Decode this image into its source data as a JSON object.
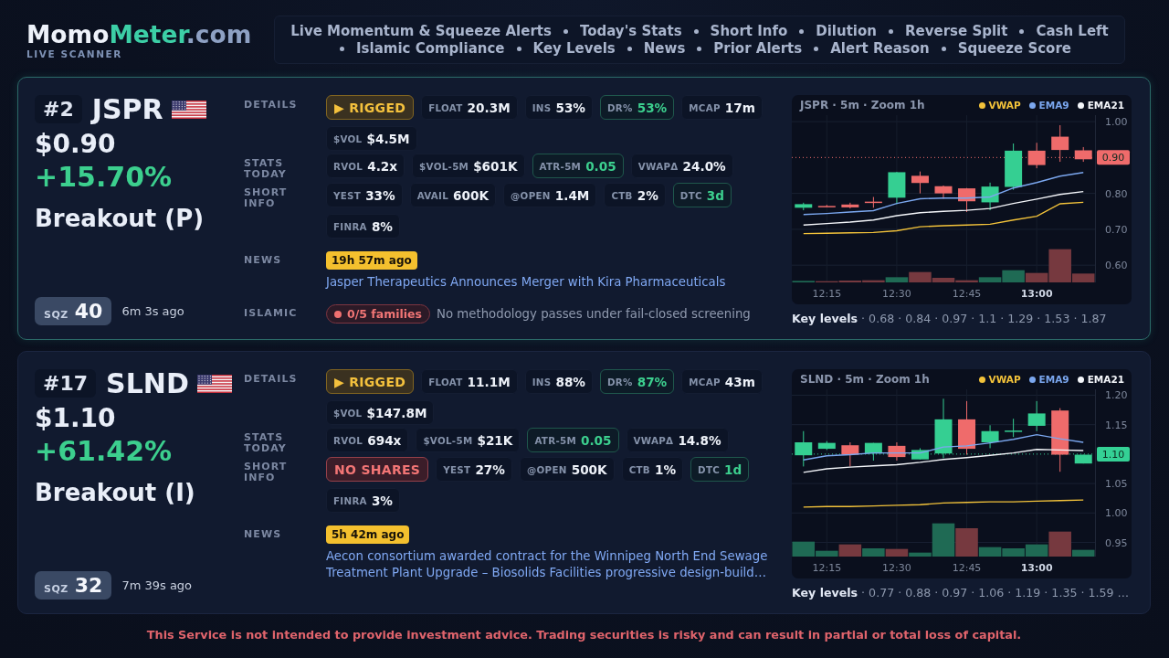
{
  "header": {
    "logo": [
      "Momo",
      "Meter",
      ".com"
    ],
    "tagline": "LIVE SCANNER",
    "nav": [
      "Live Momentum & Squeeze Alerts",
      "Today's Stats",
      "Short Info",
      "Dilution",
      "Reverse Split",
      "Cash Left",
      "Islamic Compliance",
      "Key Levels",
      "News",
      "Prior Alerts",
      "Alert Reason",
      "Squeeze Score"
    ]
  },
  "cards": [
    {
      "selected": true,
      "rank": "#2",
      "ticker": "JSPR",
      "price": "$0.90",
      "change": "+15.70%",
      "positive": true,
      "setup": "Breakout (P)",
      "sqz": {
        "label": "SQZ",
        "value": "40"
      },
      "age": "6m 3s ago",
      "sections": [
        {
          "label": "DETAILS",
          "chips": [
            {
              "kind": "warning",
              "text": "▶ RIGGED"
            },
            {
              "kind": "stat",
              "label": "FLOAT",
              "value": "20.3M",
              "positive": false
            },
            {
              "kind": "stat",
              "label": "INS",
              "value": "53%",
              "positive": false
            },
            {
              "kind": "stat",
              "label": "DR%",
              "value": "53%",
              "positive": true
            },
            {
              "kind": "stat",
              "label": "MCAP",
              "value": "17m",
              "positive": false
            },
            {
              "kind": "stat",
              "label": "$VOL",
              "value": "$4.5M",
              "positive": false
            }
          ]
        },
        {
          "label": "STATS TODAY",
          "chips": [
            {
              "kind": "stat",
              "label": "RVOL",
              "value": "4.2x",
              "positive": false
            },
            {
              "kind": "stat",
              "label": "$VOL-5M",
              "value": "$601K",
              "positive": false
            },
            {
              "kind": "stat",
              "label": "ATR-5M",
              "value": "0.05",
              "positive": true
            },
            {
              "kind": "stat",
              "label": "VWAPΔ",
              "value": "24.0%",
              "positive": false
            }
          ]
        },
        {
          "label": "SHORT INFO",
          "chips": [
            {
              "kind": "stat",
              "label": "YEST",
              "value": "33%",
              "positive": false
            },
            {
              "kind": "stat",
              "label": "AVAIL",
              "value": "600K",
              "positive": false
            },
            {
              "kind": "stat",
              "label": "@OPEN",
              "value": "1.4M",
              "positive": false
            },
            {
              "kind": "stat",
              "label": "CTB",
              "value": "2%",
              "positive": false
            },
            {
              "kind": "stat",
              "label": "DTC",
              "value": "3d",
              "positive": true
            },
            {
              "kind": "stat",
              "label": "FINRA",
              "value": "8%",
              "positive": false
            }
          ]
        }
      ],
      "news": {
        "label": "NEWS",
        "age": "19h 57m ago",
        "headline": "Jasper Therapeutics Announces Merger with Kira Pharmaceuticals"
      },
      "islamic": {
        "label": "ISLAMIC",
        "passed": false,
        "badge": "0/5 families",
        "note": "No methodology passes under fail-closed screening"
      },
      "chart": {
        "chart_data": {
          "type": "line",
          "title": "JSPR · 5m · Zoom 1h",
          "categories": [
            null,
            "12:15",
            null,
            null,
            "12:30",
            null,
            null,
            "12:45",
            null,
            null,
            "13:00",
            null,
            null
          ],
          "series": [
            {
              "name": "VWAP",
              "color": "#f2c23a",
              "values": [
                0.688,
                0.689,
                0.69,
                0.691,
                0.696,
                0.707,
                0.71,
                0.712,
                0.714,
                0.726,
                0.736,
                0.771,
                0.775
              ]
            },
            {
              "name": "EMA9",
              "color": "#7ba7ef",
              "values": [
                0.741,
                0.744,
                0.748,
                0.752,
                0.772,
                0.785,
                0.787,
                0.787,
                0.79,
                0.815,
                0.83,
                0.848,
                0.858
              ]
            },
            {
              "name": "EMA21",
              "color": "#f4f6fa",
              "values": [
                0.712,
                0.716,
                0.72,
                0.726,
                0.738,
                0.746,
                0.75,
                0.753,
                0.758,
                0.772,
                0.784,
                0.797,
                0.805
              ]
            }
          ],
          "ylim": [
            0.552,
            1.018
          ],
          "yticks": [
            {
              "value": 0.6,
              "label": "0.60"
            },
            {
              "value": 0.7,
              "label": "0.70"
            },
            {
              "value": 0.8,
              "label": "0.80"
            },
            {
              "value": 1.0,
              "label": "1.00"
            }
          ],
          "grid": true,
          "legend": "upper right",
          "ref_lines": [
            {
              "axis": "y",
              "value": 0.9,
              "label": "0.90",
              "color": "#ef6b6b"
            }
          ]
        },
        "key_levels": "**Key levels** · 0.68 · 0.84 · 0.97 · 1.1 · 1.29 · 1.53 · 1.87"
      }
    },
    {
      "selected": false,
      "rank": "#17",
      "ticker": "SLND",
      "price": "$1.10",
      "change": "+61.42%",
      "positive": true,
      "setup": "Breakout (I)",
      "sqz": {
        "label": "SQZ",
        "value": "32"
      },
      "age": "7m 39s ago",
      "sections": [
        {
          "label": "DETAILS",
          "chips": [
            {
              "kind": "warning",
              "text": "▶ RIGGED"
            },
            {
              "kind": "stat",
              "label": "FLOAT",
              "value": "11.1M",
              "positive": false
            },
            {
              "kind": "stat",
              "label": "INS",
              "value": "88%",
              "positive": false
            },
            {
              "kind": "stat",
              "label": "DR%",
              "value": "87%",
              "positive": true
            },
            {
              "kind": "stat",
              "label": "MCAP",
              "value": "43m",
              "positive": false
            },
            {
              "kind": "stat",
              "label": "$VOL",
              "value": "$147.8M",
              "positive": false
            }
          ]
        },
        {
          "label": "STATS TODAY",
          "chips": [
            {
              "kind": "stat",
              "label": "RVOL",
              "value": "694x",
              "positive": false
            },
            {
              "kind": "stat",
              "label": "$VOL-5M",
              "value": "$21K",
              "positive": false
            },
            {
              "kind": "stat",
              "label": "ATR-5M",
              "value": "0.05",
              "positive": true
            },
            {
              "kind": "stat",
              "label": "VWAPΔ",
              "value": "14.8%",
              "positive": false
            }
          ]
        },
        {
          "label": "SHORT INFO",
          "chips": [
            {
              "kind": "danger",
              "text": "NO SHARES"
            },
            {
              "kind": "stat",
              "label": "YEST",
              "value": "27%",
              "positive": false
            },
            {
              "kind": "stat",
              "label": "@OPEN",
              "value": "500K",
              "positive": false
            },
            {
              "kind": "stat",
              "label": "CTB",
              "value": "1%",
              "positive": false
            },
            {
              "kind": "stat",
              "label": "DTC",
              "value": "1d",
              "positive": true
            },
            {
              "kind": "stat",
              "label": "FINRA",
              "value": "3%",
              "positive": false
            }
          ]
        }
      ],
      "news": {
        "label": "NEWS",
        "age": "5h 42m ago",
        "headline": "Aecon consortium awarded contract for the Winnipeg North End Sewage Treatment Plant Upgrade – Biosolids Facilities progressive design-build…"
      },
      "chart": {
        "chart_data": {
          "type": "line",
          "title": "SLND · 5m · Zoom 1h",
          "categories": [
            null,
            "12:15",
            null,
            null,
            "12:30",
            null,
            null,
            "12:45",
            null,
            null,
            "13:00",
            null,
            null
          ],
          "series": [
            {
              "name": "VWAP",
              "color": "#f2c23a",
              "values": [
                1.01,
                1.011,
                1.011,
                1.012,
                1.013,
                1.014,
                1.017,
                1.018,
                1.019,
                1.019,
                1.02,
                1.021,
                1.022
              ]
            },
            {
              "name": "EMA9",
              "color": "#7ba7ef",
              "values": [
                1.09,
                1.097,
                1.099,
                1.102,
                1.102,
                1.102,
                1.112,
                1.114,
                1.119,
                1.125,
                1.133,
                1.126,
                1.12
              ]
            },
            {
              "name": "EMA21",
              "color": "#f4f6fa",
              "values": [
                1.069,
                1.075,
                1.078,
                1.08,
                1.082,
                1.086,
                1.091,
                1.094,
                1.098,
                1.102,
                1.108,
                1.107,
                1.106
              ]
            }
          ],
          "ylim": [
            0.926,
            1.21
          ],
          "yticks": [
            {
              "value": 0.95,
              "label": "0.95"
            },
            {
              "value": 1.0,
              "label": "1.00"
            },
            {
              "value": 1.05,
              "label": "1.05"
            },
            {
              "value": 1.15,
              "label": "1.15"
            },
            {
              "value": 1.2,
              "label": "1.20"
            }
          ],
          "grid": true,
          "legend": "upper right",
          "ref_lines": [
            {
              "axis": "y",
              "value": 1.1,
              "label": "1.10",
              "color": "#34d195"
            }
          ]
        },
        "key_levels": "**Key levels** · 0.77 · 0.88 · 0.97 · 1.06 · 1.19 · 1.35 · 1.59 …"
      }
    }
  ],
  "disclaimer": "This Service is not intended to provide investment advice. Trading securities is risky and can result in partial or total loss of capital."
}
